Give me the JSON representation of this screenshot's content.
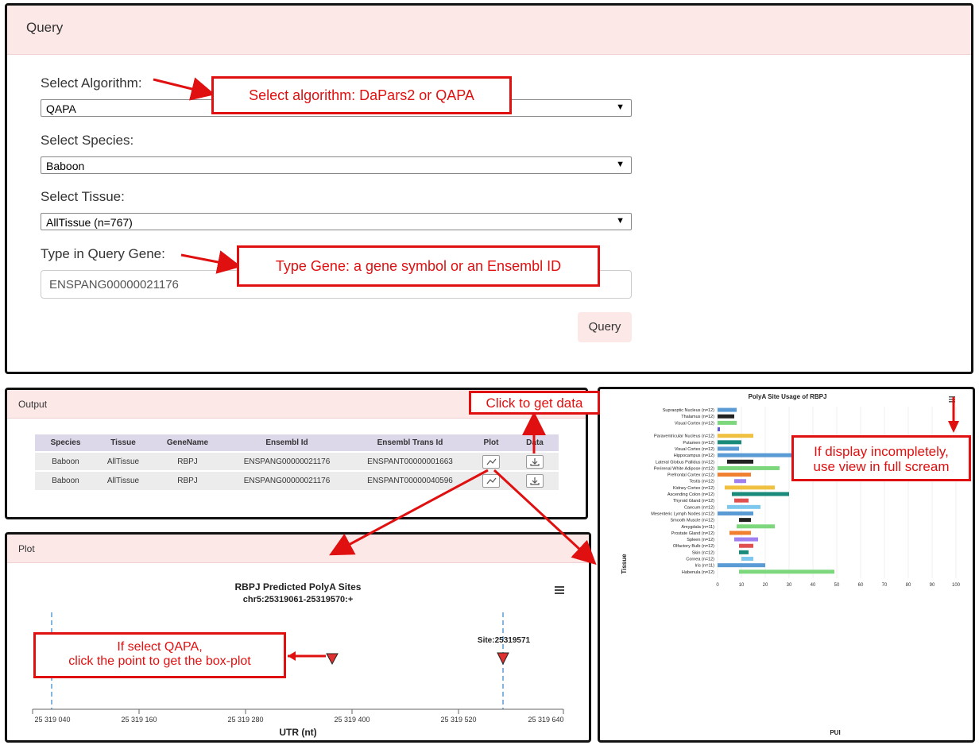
{
  "query": {
    "header": "Query",
    "algorithm_label": "Select Algorithm:",
    "algorithm_value": "QAPA",
    "species_label": "Select Species:",
    "species_value": "Baboon",
    "tissue_label": "Select Tissue:",
    "tissue_value": "AllTissue (n=767)",
    "gene_label": "Type in Query Gene:",
    "gene_value": "ENSPANG00000021176",
    "button_label": "Query"
  },
  "output": {
    "header": "Output",
    "columns": [
      "Species",
      "Tissue",
      "GeneName",
      "Ensembl Id",
      "Ensembl Trans Id",
      "Plot",
      "Data"
    ],
    "rows": [
      [
        "Baboon",
        "AllTissue",
        "RBPJ",
        "ENSPANG00000021176",
        "ENSPANT00000001663"
      ],
      [
        "Baboon",
        "AllTissue",
        "RBPJ",
        "ENSPANG00000021176",
        "ENSPANT00000040596"
      ]
    ]
  },
  "plot": {
    "header": "Plot",
    "title": "RBPJ Predicted PolyA Sites",
    "subtitle": "chr5:25319061-25319570:+",
    "site_label": "Site:25319571",
    "xlabel": "UTR (nt)",
    "ticks": [
      "25 319 040",
      "25 319 160",
      "25 319 280",
      "25 319 400",
      "25 319 520",
      "25 319 640"
    ]
  },
  "boxplot": {
    "title": "PolyA Site Usage of RBPJ",
    "ylabel": "Tissue",
    "xlabel": "PUI",
    "xticks": [
      "0",
      "10",
      "20",
      "30",
      "40",
      "50",
      "60",
      "70",
      "80",
      "90",
      "100"
    ],
    "tissues": [
      {
        "name": "Supraoptic Nucleus (n=12)",
        "lo": 0,
        "hi": 8,
        "color": "#5b9bd5"
      },
      {
        "name": "Thalamus (n=12)",
        "lo": 0,
        "hi": 7,
        "color": "#222222"
      },
      {
        "name": "Visual Cortex (n=12)",
        "lo": 0,
        "hi": 8,
        "color": "#7dd87d"
      },
      {
        "name": "",
        "lo": 0,
        "hi": 1,
        "color": "#5b5bd5"
      },
      {
        "name": "Paraventricular Nucleus (n=12)",
        "lo": 0,
        "hi": 15,
        "color": "#f0c040"
      },
      {
        "name": "Putamen (n=12)",
        "lo": 0,
        "hi": 10,
        "color": "#1a8a7a"
      },
      {
        "name": "Visual Cortex (n=12)",
        "lo": 0,
        "hi": 9,
        "color": "#5b9bd5"
      },
      {
        "name": "Hippocampus (n=12)",
        "lo": 0,
        "hi": 48,
        "color": "#5b9bd5"
      },
      {
        "name": "Lateral Globus Pallidus (n=12)",
        "lo": 4,
        "hi": 15,
        "color": "#222222"
      },
      {
        "name": "Perirenal White Adipose (n=12)",
        "lo": 0,
        "hi": 26,
        "color": "#7dd87d"
      },
      {
        "name": "Prefrontal Cortex (n=12)",
        "lo": 0,
        "hi": 14,
        "color": "#f08030"
      },
      {
        "name": "Testis (n=12)",
        "lo": 7,
        "hi": 12,
        "color": "#a080f0"
      },
      {
        "name": "Kidney Cortex (n=12)",
        "lo": 3,
        "hi": 24,
        "color": "#f0c040"
      },
      {
        "name": "Ascending Colon (n=12)",
        "lo": 6,
        "hi": 30,
        "color": "#1a8a7a"
      },
      {
        "name": "Thyroid Gland (n=12)",
        "lo": 7,
        "hi": 13,
        "color": "#e05050"
      },
      {
        "name": "Caecum (n=12)",
        "lo": 4,
        "hi": 18,
        "color": "#7ec8f0"
      },
      {
        "name": "Mesenteric Lymph Nodes (n=12)",
        "lo": 0,
        "hi": 15,
        "color": "#5b9bd5"
      },
      {
        "name": "Smooth Muscle (n=12)",
        "lo": 9,
        "hi": 14,
        "color": "#222222"
      },
      {
        "name": "Amygdala (n=11)",
        "lo": 8,
        "hi": 24,
        "color": "#7dd87d"
      },
      {
        "name": "Prostate Gland (n=12)",
        "lo": 5,
        "hi": 14,
        "color": "#f08030"
      },
      {
        "name": "Spleen (n=12)",
        "lo": 7,
        "hi": 17,
        "color": "#a080f0"
      },
      {
        "name": "Olfactory Bulb (n=12)",
        "lo": 9,
        "hi": 15,
        "color": "#e05050"
      },
      {
        "name": "Skin (n=12)",
        "lo": 9,
        "hi": 13,
        "color": "#1a8a7a"
      },
      {
        "name": "Cornea (n=12)",
        "lo": 10,
        "hi": 15,
        "color": "#7ec8f0"
      },
      {
        "name": "Iris (n=11)",
        "lo": 0,
        "hi": 20,
        "color": "#5b9bd5"
      },
      {
        "name": "Habenula (n=12)",
        "lo": 9,
        "hi": 49,
        "color": "#7dd87d"
      }
    ]
  }
}
